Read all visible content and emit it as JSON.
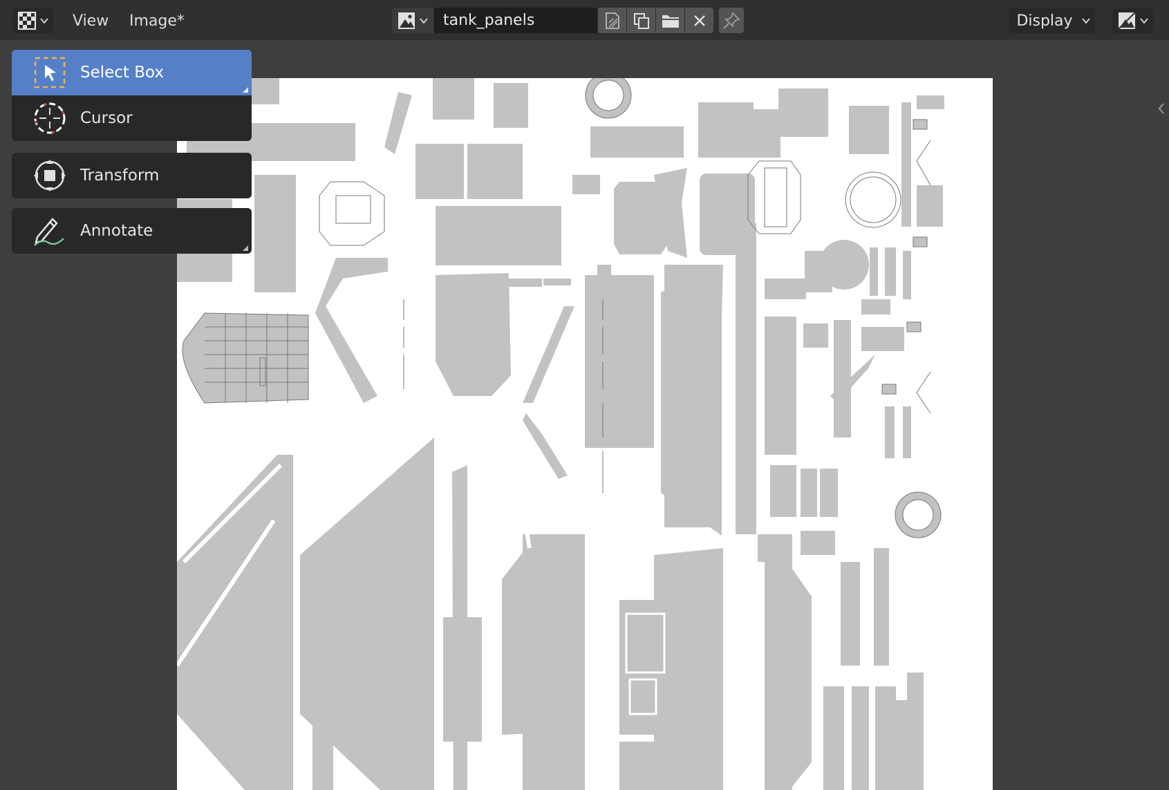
{
  "header": {
    "editor_type_icon": "uv-image-editor-icon",
    "menus": [
      {
        "label": "View"
      },
      {
        "label": "Image*"
      }
    ],
    "image_browse_icon": "image-browse-icon",
    "image_name": "tank_panels",
    "image_buttons": [
      {
        "icon": "new-image-icon"
      },
      {
        "icon": "duplicate-icon"
      },
      {
        "icon": "open-folder-icon"
      },
      {
        "icon": "close-icon"
      }
    ],
    "pin_icon": "pin-icon",
    "display_label": "Display",
    "display_mode_icon": "display-channels-icon"
  },
  "toolbar": {
    "tools": [
      {
        "label": "Select Box",
        "icon": "select-box-icon",
        "active": true
      },
      {
        "label": "Cursor",
        "icon": "cursor-icon",
        "active": false
      },
      {
        "label": "Transform",
        "icon": "transform-icon",
        "active": false
      },
      {
        "label": "Annotate",
        "icon": "annotate-icon",
        "active": false
      }
    ]
  },
  "viewport": {
    "image": "tank_panels texture (UV layout, gray islands on white)",
    "sidebar_toggle_icon": "chevron-left-icon"
  },
  "colors": {
    "header_bg": "#303030",
    "viewport_bg": "#3e3e3e",
    "active_tool": "#5580c8",
    "island": "#c0c0c0",
    "texture_bg": "#ffffff"
  }
}
